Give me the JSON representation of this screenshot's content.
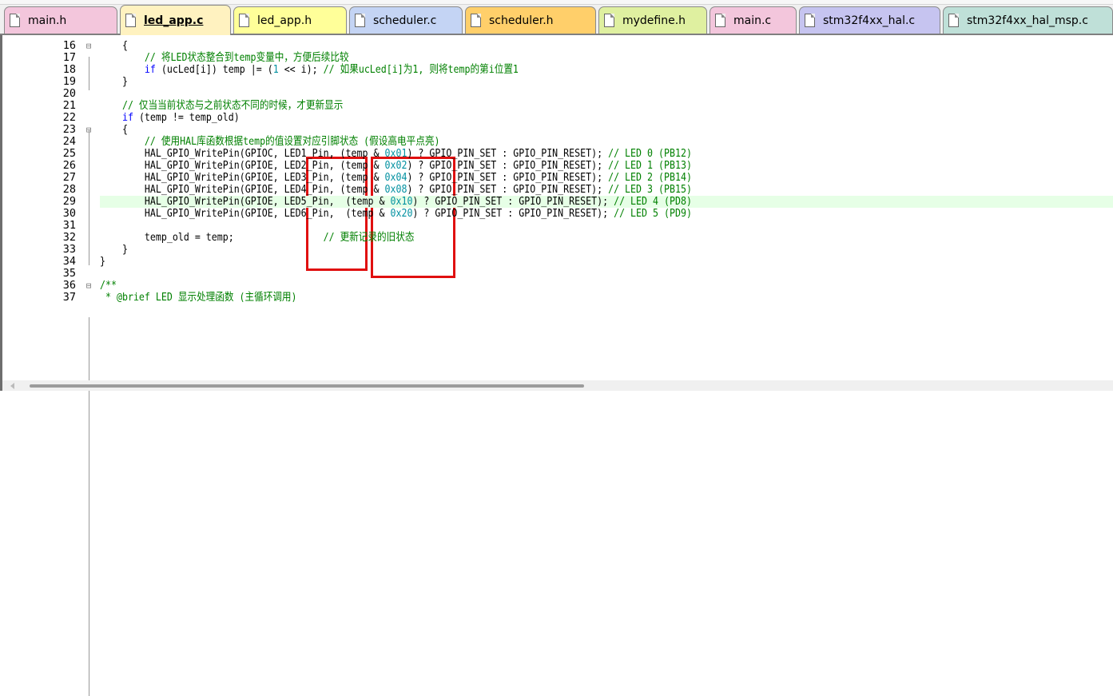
{
  "tabs": [
    {
      "label": "main.h",
      "color": "#f3c6dc",
      "active": false
    },
    {
      "label": "led_app.c",
      "color": "#fff2c0",
      "active": true
    },
    {
      "label": "led_app.h",
      "color": "#ffff99",
      "active": false
    },
    {
      "label": "scheduler.c",
      "color": "#c4d4f4",
      "active": false
    },
    {
      "label": "scheduler.h",
      "color": "#ffcf6a",
      "active": false
    },
    {
      "label": "mydefine.h",
      "color": "#dff0a0",
      "active": false
    },
    {
      "label": "main.c",
      "color": "#f3c6dc",
      "active": false
    },
    {
      "label": "stm32f4xx_hal.c",
      "color": "#c6c4f0",
      "active": false
    },
    {
      "label": "stm32f4xx_hal_msp.c",
      "color": "#bfe0d8",
      "active": false
    }
  ],
  "lines": [
    {
      "n": "16",
      "html": "    {"
    },
    {
      "n": "17",
      "html": "        <span class=\"cm\">// 将LED状态整合到temp变量中，方便后续比较</span>"
    },
    {
      "n": "18",
      "html": "        <span class=\"kw\">if</span> (ucLed[i]) temp |= (<span class=\"num\">1</span> &lt;&lt; i); <span class=\"cm\">// 如果ucLed[i]为1, 则将temp的第i位置1</span>"
    },
    {
      "n": "19",
      "html": "    }"
    },
    {
      "n": "20",
      "html": ""
    },
    {
      "n": "21",
      "html": "    <span class=\"cm\">// 仅当当前状态与之前状态不同的时候，才更新显示</span>"
    },
    {
      "n": "22",
      "html": "    <span class=\"kw\">if</span> (temp != temp_old)"
    },
    {
      "n": "23",
      "html": "    {"
    },
    {
      "n": "24",
      "html": "        <span class=\"cm\">// 使用HAL库函数根据temp的值设置对应引脚状态 (假设高电平点亮)</span>"
    },
    {
      "n": "25",
      "html": "        HAL_GPIO_WritePin(GPIOC, LED1_Pin, (temp &amp; <span class=\"num\">0x01</span>) ? GPIO_PIN_SET : GPIO_PIN_RESET); <span class=\"cm\">// LED 0 (PB12)</span>"
    },
    {
      "n": "26",
      "html": "        HAL_GPIO_WritePin(GPIOE, LED2_Pin, (temp &amp; <span class=\"num\">0x02</span>) ? GPIO_PIN_SET : GPIO_PIN_RESET); <span class=\"cm\">// LED 1 (PB13)</span>"
    },
    {
      "n": "27",
      "html": "        HAL_GPIO_WritePin(GPIOE, LED3_Pin, (temp &amp; <span class=\"num\">0x04</span>) ? GPIO_PIN_SET : GPIO_PIN_RESET); <span class=\"cm\">// LED 2 (PB14)</span>"
    },
    {
      "n": "28",
      "html": "        HAL_GPIO_WritePin(GPIOE, LED4_Pin, (temp &amp; <span class=\"num\">0x08</span>) ? GPIO_PIN_SET : GPIO_PIN_RESET); <span class=\"cm\">// LED 3 (PB15)</span>"
    },
    {
      "n": "29",
      "html": "        HAL_GPIO_WritePin(GPIOE, LED5_Pin,  (temp &amp; <span class=\"num\">0x10</span>) ? GPIO_PIN_SET : GPIO_PIN_RESET); <span class=\"cm\">// LED 4 (PD8)</span>"
    },
    {
      "n": "30",
      "html": "        HAL_GPIO_WritePin(GPIOE, LED6_Pin,  (temp &amp; <span class=\"num\">0x20</span>) ? GPIO_PIN_SET : GPIO_PIN_RESET); <span class=\"cm\">// LED 5 (PD9)</span>"
    },
    {
      "n": "31",
      "html": ""
    },
    {
      "n": "32",
      "html": "        temp_old = temp;                <span class=\"cm\">// 更新记录的旧状态</span>"
    },
    {
      "n": "33",
      "html": "    }"
    },
    {
      "n": "34",
      "html": "}"
    },
    {
      "n": "35",
      "html": ""
    },
    {
      "n": "36",
      "html": "<span class=\"cm\">/**</span>"
    },
    {
      "n": "37",
      "html": "<span class=\"cm\"> * @brief LED 显示处理函数 (主循环调用)</span>"
    }
  ],
  "highlighted_line": "29",
  "fold_markers": {
    "16": "box",
    "23": "box",
    "36": "box"
  }
}
